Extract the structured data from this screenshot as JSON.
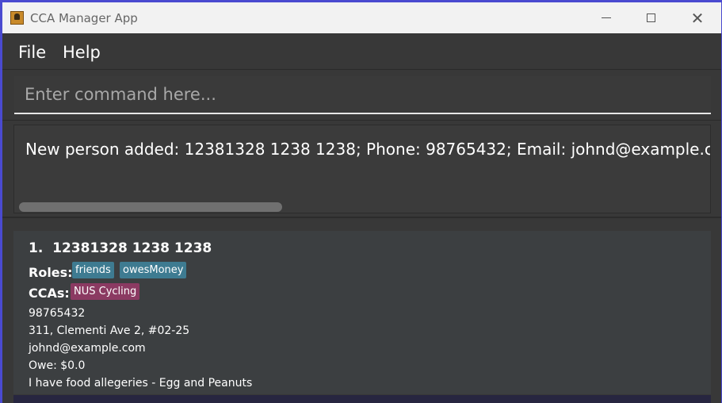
{
  "window": {
    "title": "CCA Manager App",
    "app_icon": "address-book-icon",
    "controls": {
      "minimize": "minimize-icon",
      "maximize": "maximize-icon",
      "close": "close-icon"
    }
  },
  "menu": {
    "items": [
      {
        "label": "File"
      },
      {
        "label": "Help"
      }
    ]
  },
  "command": {
    "placeholder": "Enter command here...",
    "value": ""
  },
  "result": {
    "text": "New person added: 12381328 1238 1238; Phone: 98765432; Email: johnd@example.com; Address"
  },
  "persons": [
    {
      "index": "1.",
      "name": "12381328 1238 1238",
      "roles_label": "Roles:",
      "roles": [
        "friends",
        "owesMoney"
      ],
      "ccas_label": "CCAs:",
      "ccas": [
        "NUS Cycling"
      ],
      "phone": "98765432",
      "address": "311, Clementi Ave 2, #02-25",
      "email": "johnd@example.com",
      "owe": "Owe: $0.0",
      "remark": "I have food allegeries - Egg and Peanuts"
    }
  ],
  "colors": {
    "background": "#383838",
    "role_tag": "#3e7b91",
    "cca_tag": "#8b3a62",
    "card": "#3c3f41"
  }
}
